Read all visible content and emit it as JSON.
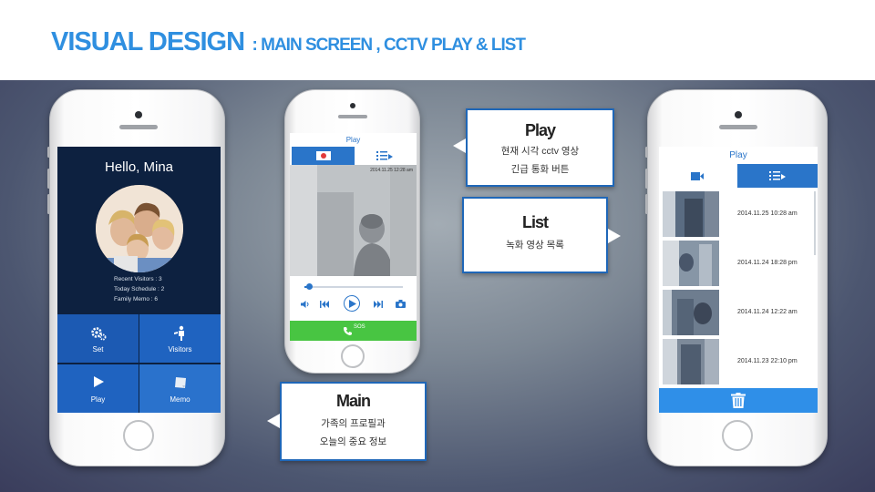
{
  "header": {
    "title_main": "VISUAL DESIGN",
    "title_sub": ": MAIN SCREEN , CCTV PLAY & LIST",
    "title_color": "#2f8fe0"
  },
  "main_screen": {
    "greeting": "Hello, Mina",
    "stats": [
      "Recent Visitors : 3",
      "Today Schedule : 2",
      "Family Memo : 6"
    ],
    "tiles": [
      {
        "label": "Set",
        "icon": "gear-icon",
        "color": "#1c5ab3"
      },
      {
        "label": "Visitors",
        "icon": "visitor-icon",
        "color": "#1f63c0"
      },
      {
        "label": "Play",
        "icon": "play-icon",
        "color": "#1f63c0"
      },
      {
        "label": "Memo",
        "icon": "memo-icon",
        "color": "#2a72cc"
      }
    ]
  },
  "play_screen": {
    "title": "Play",
    "timestamp": "2014.11.25   12:28 am",
    "progress": 0.05,
    "sos_label": "SOS",
    "accent": "#2a75c9",
    "sos_color": "#48c542"
  },
  "list_screen": {
    "title": "Play",
    "recordings": [
      {
        "timestamp": "2014.11.25   10:28 am"
      },
      {
        "timestamp": "2014.11.24   18:28 pm"
      },
      {
        "timestamp": "2014.11.24   12:22 am"
      },
      {
        "timestamp": "2014.11.23   22:10 pm"
      }
    ],
    "trash_color": "#2f8fe8"
  },
  "callouts": {
    "play": {
      "heading": "Play",
      "lines": [
        "현재 시각 cctv 영상",
        "긴급 통화 버튼"
      ]
    },
    "list": {
      "heading": "List",
      "lines": [
        "녹화 영상 목록"
      ]
    },
    "main": {
      "heading": "Main",
      "lines": [
        "가족의 프로필과",
        "오늘의 중요 정보"
      ]
    },
    "border_color": "#1f67b8"
  }
}
